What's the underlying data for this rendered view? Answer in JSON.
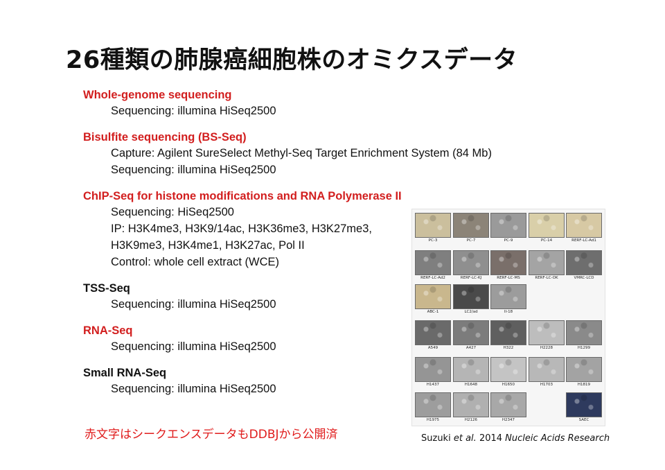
{
  "title": "26種類の肺腺癌細胞株のオミクスデータ",
  "sections": [
    {
      "heading": "Whole-genome sequencing",
      "color": "red",
      "lines": [
        "Sequencing: illumina HiSeq2500"
      ]
    },
    {
      "heading": "Bisulfite sequencing (BS-Seq)",
      "color": "red",
      "lines": [
        "Capture: Agilent SureSelect Methyl-Seq Target Enrichment System (84 Mb)",
        "Sequencing: illumina HiSeq2500"
      ]
    },
    {
      "heading": "ChIP-Seq for histone modifications and RNA Polymerase II",
      "color": "red",
      "lines": [
        "Sequencing: HiSeq2500",
        "IP: H3K4me3, H3K9/14ac, H3K36me3, H3K27me3,",
        "H3K9me3, H3K4me1, H3K27ac, Pol II",
        "Control: whole cell extract (WCE)"
      ]
    },
    {
      "heading": "TSS-Seq",
      "color": "black",
      "lines": [
        "Sequencing: illumina HiSeq2500"
      ]
    },
    {
      "heading": "RNA-Seq",
      "color": "red",
      "lines": [
        "Sequencing: illumina HiSeq2500"
      ]
    },
    {
      "heading": "Small RNA-Seq",
      "color": "black",
      "lines": [
        "Sequencing: illumina HiSeq2500"
      ]
    }
  ],
  "footer_note": "赤文字はシークエンスデータもDDBJから公開済",
  "figure": {
    "cells": [
      {
        "label": "PC-3",
        "tone": "#cbbf9d"
      },
      {
        "label": "PC-7",
        "tone": "#8c8478"
      },
      {
        "label": "PC-9",
        "tone": "#9a9a9a"
      },
      {
        "label": "PC-14",
        "tone": "#d9cfa9"
      },
      {
        "label": "RERF-LC-Ad1",
        "tone": "#d7c9a4"
      },
      {
        "label": "RERF-LC-Ad2",
        "tone": "#7f7f7f"
      },
      {
        "label": "RERF-LC-KJ",
        "tone": "#8f8f8f"
      },
      {
        "label": "RERF-LC-MS",
        "tone": "#7a6f6a"
      },
      {
        "label": "RERF-LC-OK",
        "tone": "#a4a4a4"
      },
      {
        "label": "VMRC-LCD",
        "tone": "#6e6e6e"
      },
      {
        "label": "ABC-1",
        "tone": "#c9b78d"
      },
      {
        "label": "LC2/ad",
        "tone": "#4a4a4a"
      },
      {
        "label": "II-18",
        "tone": "#9c9c9c"
      },
      null,
      null,
      {
        "label": "A549",
        "tone": "#6a6a6a"
      },
      {
        "label": "A427",
        "tone": "#7c7c7c"
      },
      {
        "label": "H322",
        "tone": "#5f5f5f"
      },
      {
        "label": "H2228",
        "tone": "#bdbdbd"
      },
      {
        "label": "H1299",
        "tone": "#8a8a8a"
      },
      {
        "label": "H1437",
        "tone": "#959595"
      },
      {
        "label": "H1648",
        "tone": "#b5b5b5"
      },
      {
        "label": "H1650",
        "tone": "#c4c4c4"
      },
      {
        "label": "H1703",
        "tone": "#b8b8b8"
      },
      {
        "label": "H1819",
        "tone": "#a3a3a3"
      },
      {
        "label": "H1975",
        "tone": "#9d9d9d"
      },
      {
        "label": "H2126",
        "tone": "#b0b0b0"
      },
      {
        "label": "H2347",
        "tone": "#a8a8a8"
      },
      null,
      {
        "label": "SAEC",
        "tone": "#2e3a5e"
      }
    ]
  },
  "citation": {
    "author": "Suzuki",
    "etal": "et al.",
    "year": "2014",
    "journal": "Nucleic Acids Research"
  }
}
